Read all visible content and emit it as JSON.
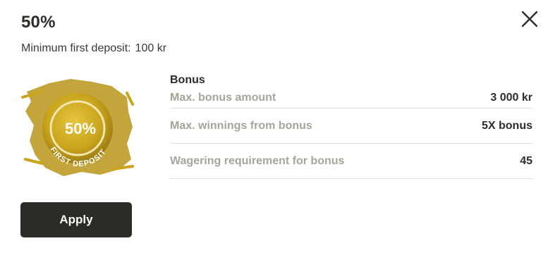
{
  "offer": {
    "title": "50%",
    "min_deposit_label": "Minimum first deposit:",
    "min_deposit_value": "100 kr"
  },
  "badge": {
    "percent": "50%",
    "caption": "FIRST DEPOSIT",
    "colors": {
      "gold": "#c9a41c",
      "gold_dark": "#8f7412",
      "gold_light": "#e6c440"
    }
  },
  "details": {
    "heading": "Bonus",
    "rows": [
      {
        "label": "Max. bonus amount",
        "value": "3 000 kr"
      },
      {
        "label": "Max. winnings from bonus",
        "value": "5X bonus"
      },
      {
        "label": "Wagering requirement for bonus",
        "value": "45"
      }
    ]
  },
  "actions": {
    "apply_label": "Apply"
  },
  "icons": {
    "close": "close-icon"
  }
}
